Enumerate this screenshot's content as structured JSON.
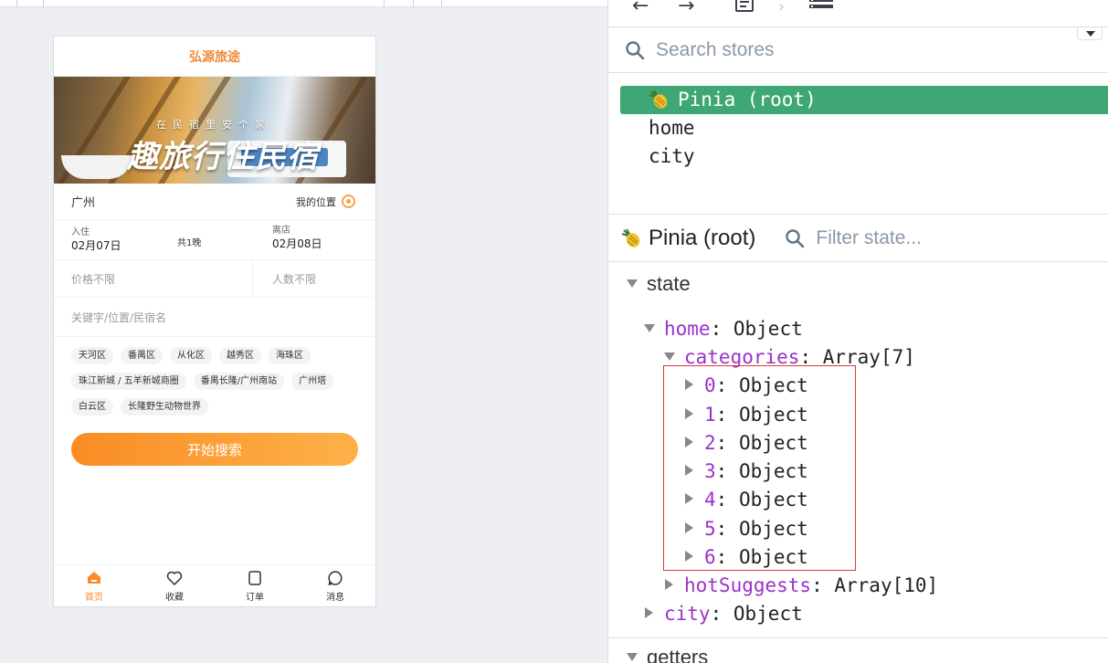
{
  "phone": {
    "header_title": "弘源旅途",
    "banner": {
      "subtitle": "在民宿里安个家",
      "title": "趣旅行住民宿"
    },
    "city": {
      "name": "广州",
      "my_location": "我的位置"
    },
    "dates": {
      "checkin_label": "入住",
      "checkin_date": "02月07日",
      "nights": "共1晚",
      "checkout_label": "离店",
      "checkout_date": "02月08日"
    },
    "filters": {
      "price": "价格不限",
      "people": "人数不限"
    },
    "keyword_placeholder": "关键字/位置/民宿名",
    "hot_tags": [
      "天河区",
      "番禺区",
      "从化区",
      "越秀区",
      "海珠区",
      "珠江新城 / 五羊新城商圈",
      "番禺长隆/广州南站",
      "广州塔",
      "白云区",
      "长隆野生动物世界"
    ],
    "search_button": "开始搜索",
    "tabbar": [
      {
        "label": "首页",
        "icon": "home-icon",
        "active": true
      },
      {
        "label": "收藏",
        "icon": "heart-icon",
        "active": false
      },
      {
        "label": "订单",
        "icon": "order-icon",
        "active": false
      },
      {
        "label": "消息",
        "icon": "message-icon",
        "active": false
      }
    ],
    "accent_color": "#fb8a28"
  },
  "devtools": {
    "search_stores_placeholder": "Search stores",
    "stores": [
      "Pinia (root)",
      "home",
      "city"
    ],
    "selected_store": "Pinia (root)",
    "inspector_title": "Pinia (root)",
    "filter_placeholder": "Filter state...",
    "sections": {
      "state": "state",
      "getters": "getters"
    },
    "tree": {
      "home_key": "home",
      "home_type": "Object",
      "categories_key": "categories",
      "categories_type": "Array[7]",
      "items": [
        {
          "key": "0",
          "type": "Object"
        },
        {
          "key": "1",
          "type": "Object"
        },
        {
          "key": "2",
          "type": "Object"
        },
        {
          "key": "3",
          "type": "Object"
        },
        {
          "key": "4",
          "type": "Object"
        },
        {
          "key": "5",
          "type": "Object"
        },
        {
          "key": "6",
          "type": "Object"
        }
      ],
      "hot_key": "hotSuggests",
      "hot_type": "Array[10]",
      "city_key": "city",
      "city_type": "Object"
    },
    "selected_color": "#3fa773",
    "key_color": "#9a32c9",
    "highlight_color": "#d63a3a"
  }
}
